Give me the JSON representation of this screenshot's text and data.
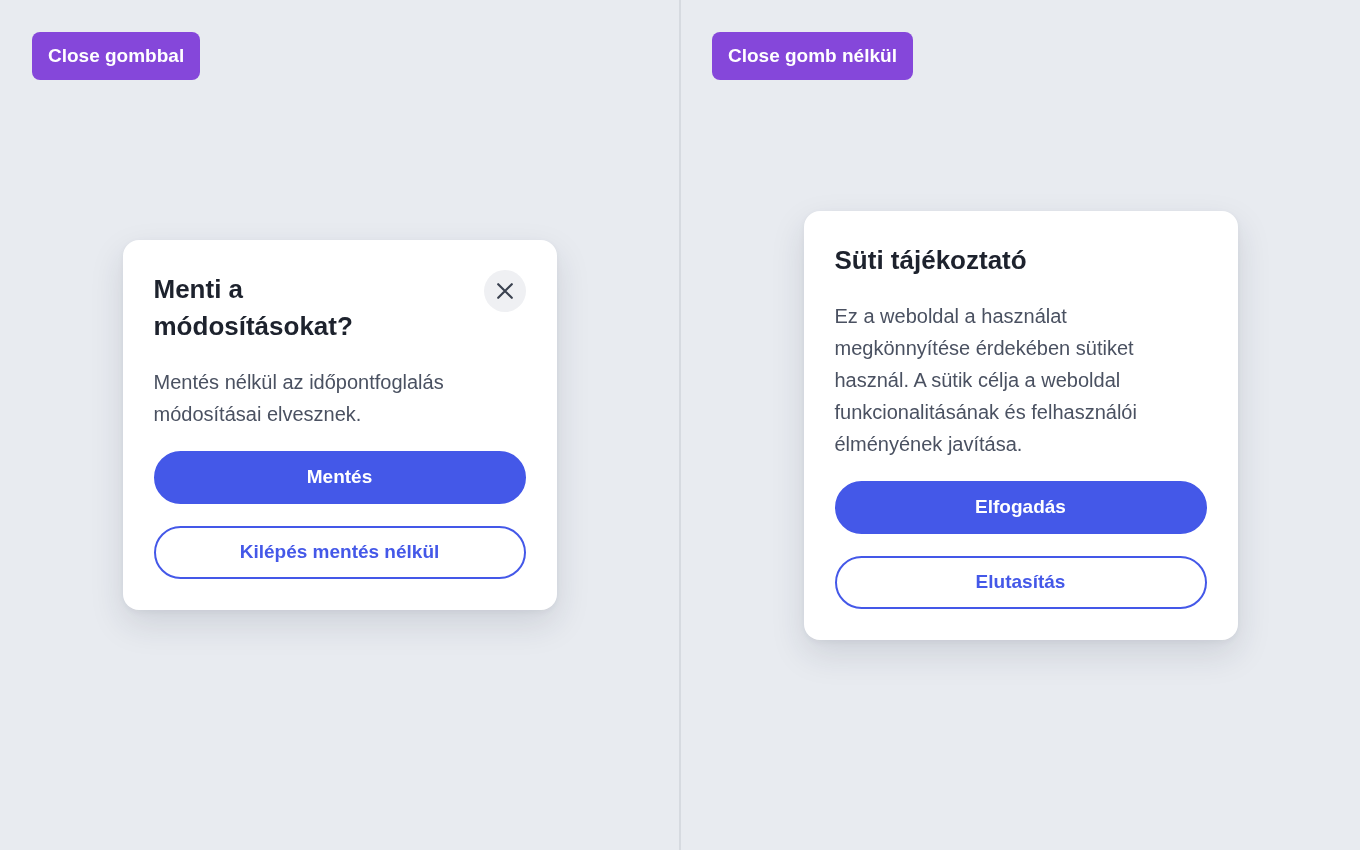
{
  "panels": [
    {
      "tag": "Close gombbal",
      "dialog": {
        "title": "Menti a módosításokat?",
        "close_button": true,
        "body": "Mentés nélkül az időpontfoglalás módosításai elvesznek.",
        "buttons": [
          {
            "label": "Mentés",
            "kind": "primary"
          },
          {
            "label": "Kilépés mentés nélkül",
            "kind": "outline"
          }
        ]
      }
    },
    {
      "tag": "Close gomb nélkül",
      "dialog": {
        "title": "Süti tájékoztató",
        "close_button": false,
        "body": "Ez a weboldal a használat megkönnyítése érdekében sütiket használ. A sütik célja a weboldal funkcionalitásának és felhasználói élményének javítása.",
        "buttons": [
          {
            "label": "Elfogadás",
            "kind": "primary"
          },
          {
            "label": "Elutasítás",
            "kind": "outline"
          }
        ]
      }
    }
  ]
}
